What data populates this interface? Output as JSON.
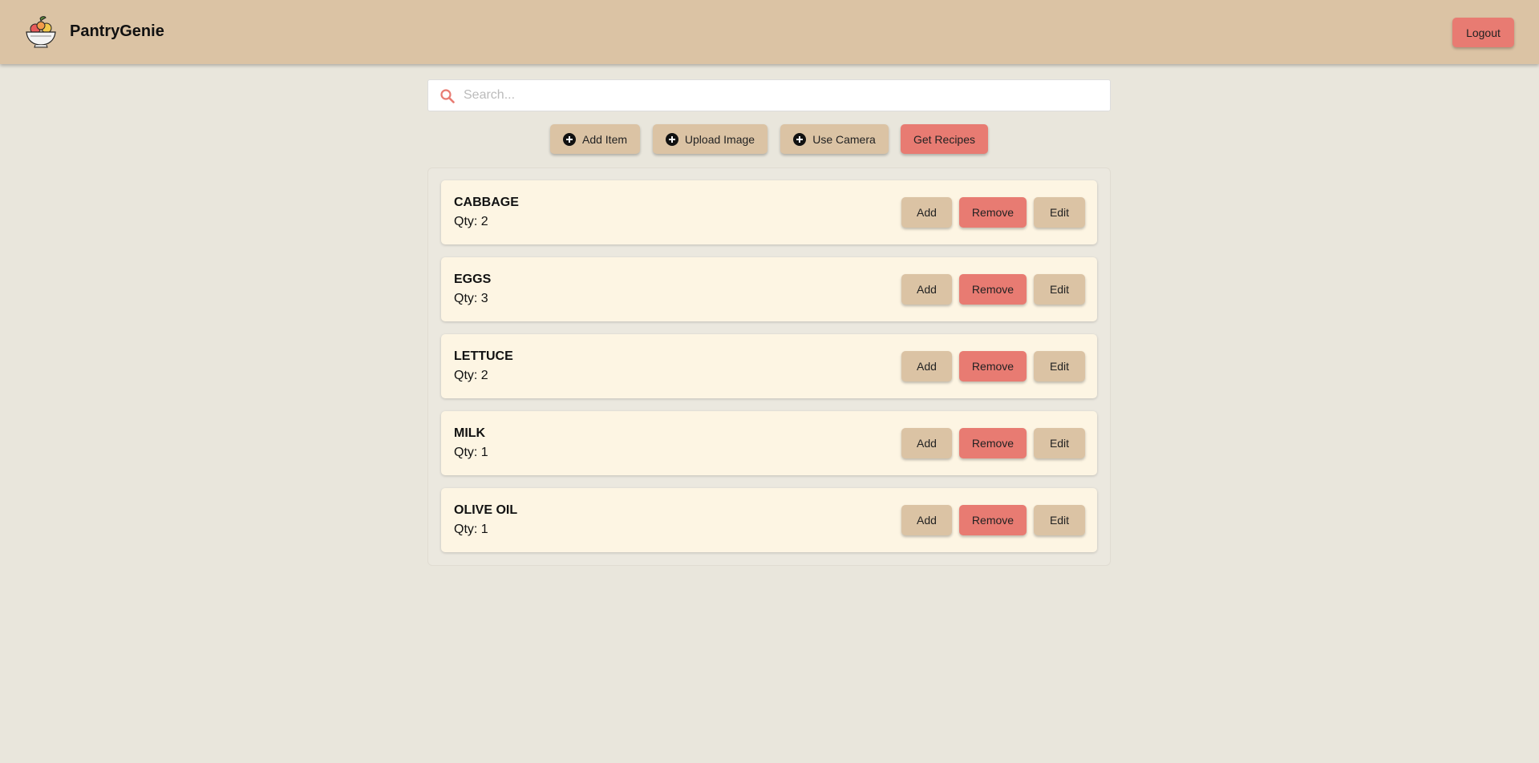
{
  "header": {
    "app_title": "PantryGenie",
    "logo_icon": "fruit-bowl-icon",
    "logout_label": "Logout"
  },
  "search": {
    "placeholder": "Search...",
    "value": "",
    "icon": "search-icon"
  },
  "actions": {
    "add_item_label": "Add Item",
    "upload_image_label": "Upload Image",
    "use_camera_label": "Use Camera",
    "get_recipes_label": "Get Recipes"
  },
  "items": [
    {
      "name": "CABBAGE",
      "qty": "Qty: 2",
      "add_label": "Add",
      "remove_label": "Remove",
      "edit_label": "Edit"
    },
    {
      "name": "EGGS",
      "qty": "Qty: 3",
      "add_label": "Add",
      "remove_label": "Remove",
      "edit_label": "Edit"
    },
    {
      "name": "LETTUCE",
      "qty": "Qty: 2",
      "add_label": "Add",
      "remove_label": "Remove",
      "edit_label": "Edit"
    },
    {
      "name": "MILK",
      "qty": "Qty: 1",
      "add_label": "Add",
      "remove_label": "Remove",
      "edit_label": "Edit"
    },
    {
      "name": "OLIVE OIL",
      "qty": "Qty: 1",
      "add_label": "Add",
      "remove_label": "Remove",
      "edit_label": "Edit"
    }
  ],
  "colors": {
    "header_bg": "#dbc3a4",
    "page_bg": "#e9e6dc",
    "accent_red": "#e87b72",
    "card_bg": "#fdf5e3"
  }
}
